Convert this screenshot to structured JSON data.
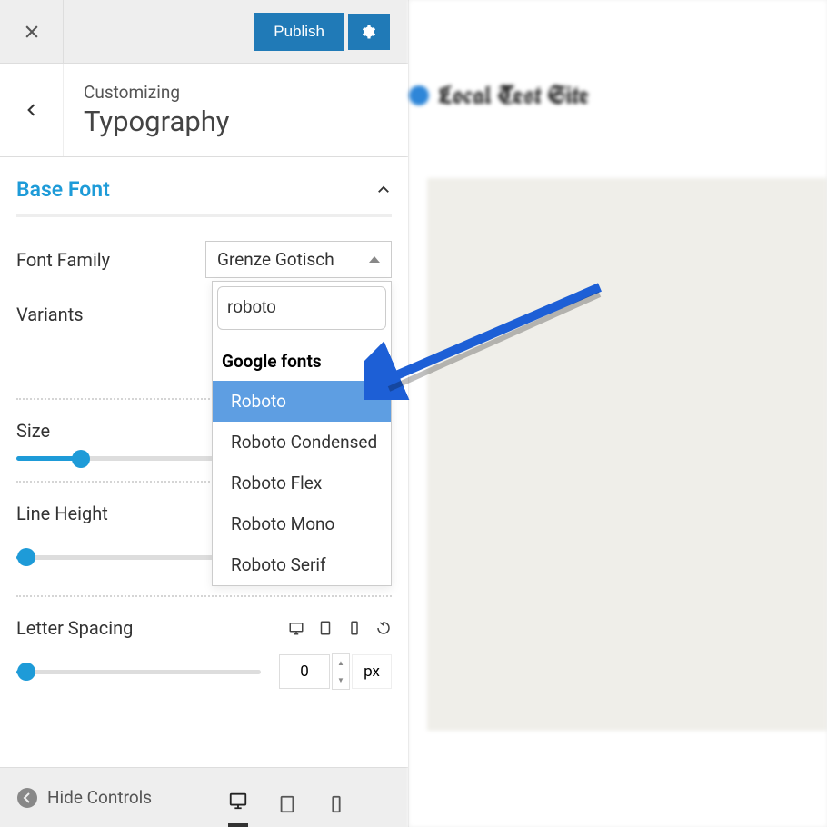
{
  "topBar": {
    "publishLabel": "Publish"
  },
  "panelHeader": {
    "customizingLabel": "Customizing",
    "title": "Typography"
  },
  "baseFont": {
    "headTitle": "Base Font",
    "fontFamilyLabel": "Font Family",
    "fontFamilyValue": "Grenze Gotisch",
    "variantsLabel": "Variants",
    "dropdown": {
      "searchValue": "roboto",
      "groupTitle": "Google fonts",
      "options": [
        "Roboto",
        "Roboto Condensed",
        "Roboto Flex",
        "Roboto Mono",
        "Roboto Serif"
      ],
      "selectedIndex": 0
    },
    "sizeLabel": "Size",
    "sizeSliderPercent": 18,
    "lineHeightLabel": "Line Height",
    "lineHeightSliderPercent": 4,
    "letterSpacingLabel": "Letter Spacing",
    "letterSpacingValue": "0",
    "letterSpacingUnit": "px",
    "letterSpacingSliderPercent": 4
  },
  "footer": {
    "hideControlsLabel": "Hide Controls"
  },
  "preview": {
    "siteTitle": "Local Test Site"
  }
}
